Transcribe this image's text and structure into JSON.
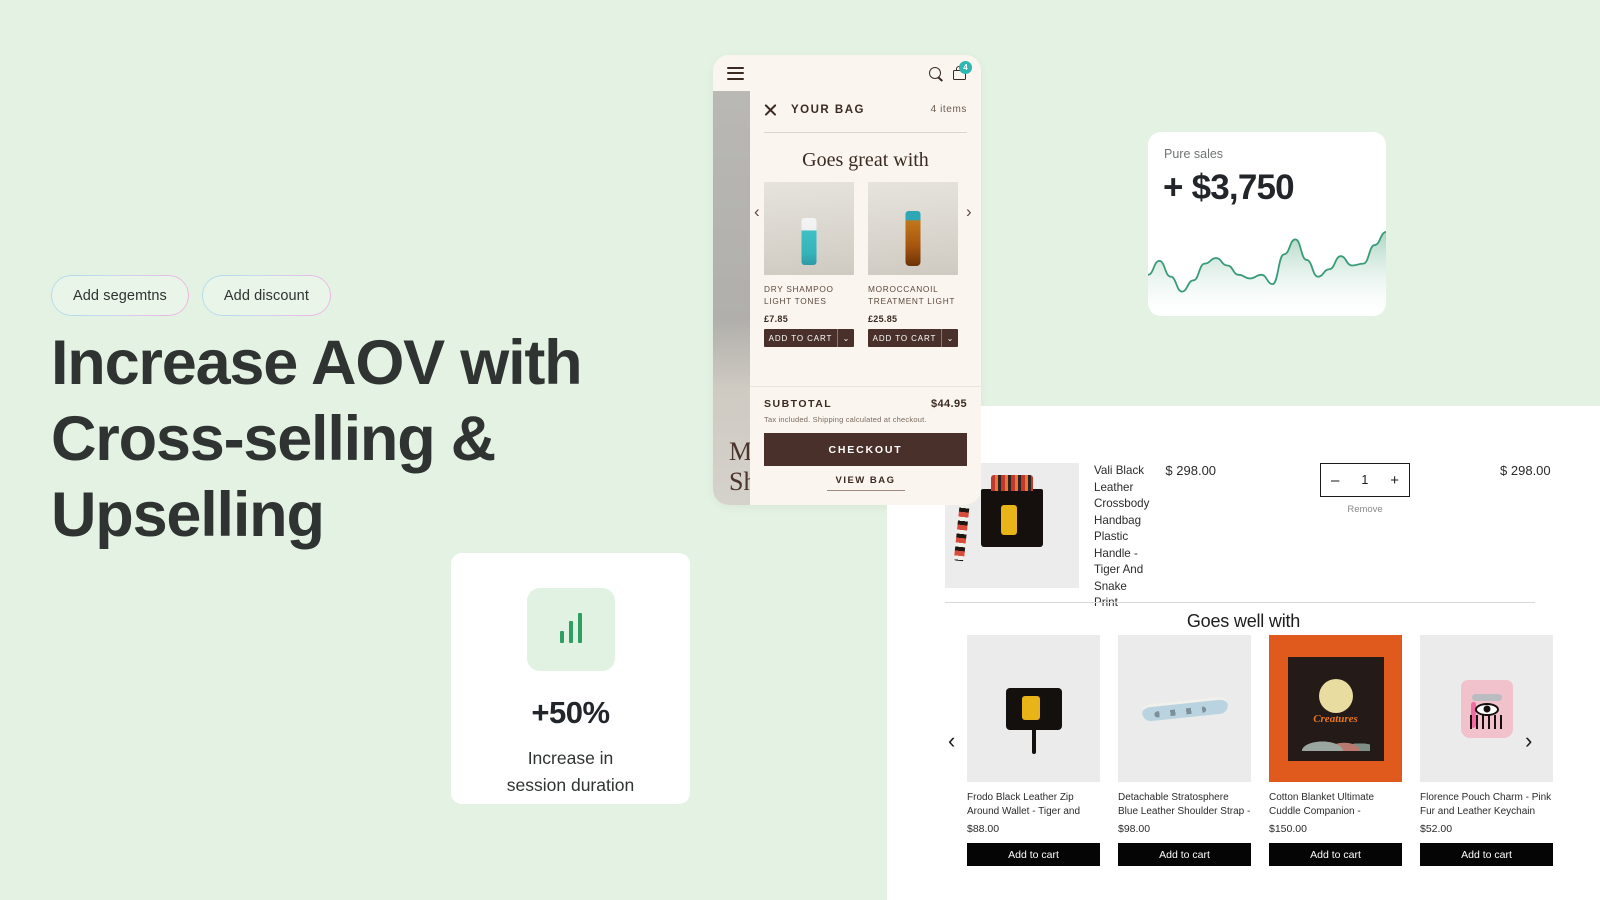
{
  "theme": {
    "background": "#e4f2e4",
    "accent_green": "#2f9e63",
    "dark_brown": "#4a302a",
    "badge_teal": "#2eb6b0",
    "card_white": "#ffffff"
  },
  "hero": {
    "pills": [
      {
        "label": "Add segemtns",
        "name": "add-segments-pill"
      },
      {
        "label": "Add discount",
        "name": "add-discount-pill"
      }
    ],
    "title": "Increase AOV with Cross-selling & Upselling"
  },
  "stat_card": {
    "icon": "bar-chart-icon",
    "value": "+50%",
    "caption_line1": "Increase in",
    "caption_line2": "session duration"
  },
  "sales_card": {
    "label": "Pure sales",
    "value": "+ $3,750"
  },
  "chart_data": {
    "type": "area",
    "title": "Pure sales",
    "x": [
      0,
      1,
      2,
      3,
      4,
      5,
      6,
      7,
      8,
      9,
      10,
      11,
      12,
      13,
      14,
      15,
      16,
      17,
      18,
      19,
      20
    ],
    "values": [
      40,
      55,
      38,
      22,
      34,
      52,
      58,
      50,
      40,
      36,
      40,
      30,
      62,
      78,
      56,
      38,
      46,
      60,
      50,
      52,
      72,
      86
    ],
    "series": [
      {
        "name": "Pure sales",
        "values": [
          40,
          55,
          38,
          22,
          34,
          52,
          58,
          50,
          40,
          36,
          40,
          30,
          62,
          78,
          56,
          38,
          46,
          60,
          50,
          52,
          72,
          86
        ]
      }
    ],
    "xlabel": "",
    "ylabel": "",
    "ylim": [
      0,
      100
    ],
    "grid": false,
    "legend": false,
    "line_color": "#3a9b78",
    "fill_gradient": [
      "#9ecdb9",
      "#ffffff"
    ]
  },
  "phone": {
    "topbar": {
      "menu_icon": "hamburger-icon",
      "search_icon": "search-icon",
      "bag_icon": "shopping-bag-icon",
      "bag_badge": "4"
    },
    "background_text_line1": "M",
    "background_text_line2": "Sh",
    "drawer": {
      "close_icon": "close-icon",
      "title": "YOUR BAG",
      "item_count": "4 items",
      "recommend_heading": "Goes great with",
      "prev_arrow": "‹",
      "next_arrow": "›",
      "recommendations": [
        {
          "name": "DRY SHAMPOO LIGHT TONES",
          "price": "£7.85",
          "button_label": "ADD TO CART",
          "caret": "⌄"
        },
        {
          "name": "MOROCCANOIL TREATMENT LIGHT",
          "price": "£25.85",
          "button_label": "ADD TO CART",
          "caret": "⌄"
        }
      ],
      "subtotal_label": "SUBTOTAL",
      "subtotal_value": "$44.95",
      "tax_note": "Tax included. Shipping calculated at checkout.",
      "checkout_label": "CHECKOUT",
      "view_bag_label": "VIEW BAG"
    }
  },
  "desktop_cart": {
    "menu_icon": "hamburger-icon",
    "line_item": {
      "title": "Vali Black Leather Crossbody Handbag Plastic Handle - Tiger And Snake Print",
      "unit_price": "$ 298.00",
      "quantity": "1",
      "decrement": "–",
      "increment": "+",
      "remove_label": "Remove",
      "line_total": "$ 298.00"
    },
    "recommend_heading": "Goes well with",
    "prev_arrow": "‹",
    "next_arrow": "›",
    "products": [
      {
        "title": "Frodo Black Leather Zip Around Wallet - Tiger and Snake...",
        "price": "$88.00",
        "button_label": "Add to cart"
      },
      {
        "title": "Detachable Stratosphere Blue Leather Shoulder Strap - All...",
        "price": "$98.00",
        "button_label": "Add to cart"
      },
      {
        "title": "Cotton Blanket Ultimate Cuddle Companion - Woodlands",
        "price": "$150.00",
        "button_label": "Add to cart"
      },
      {
        "title": "Florence Pouch Charm - Pink Fur and Leather Keychain Eye...",
        "price": "$52.00",
        "button_label": "Add to cart"
      }
    ]
  }
}
